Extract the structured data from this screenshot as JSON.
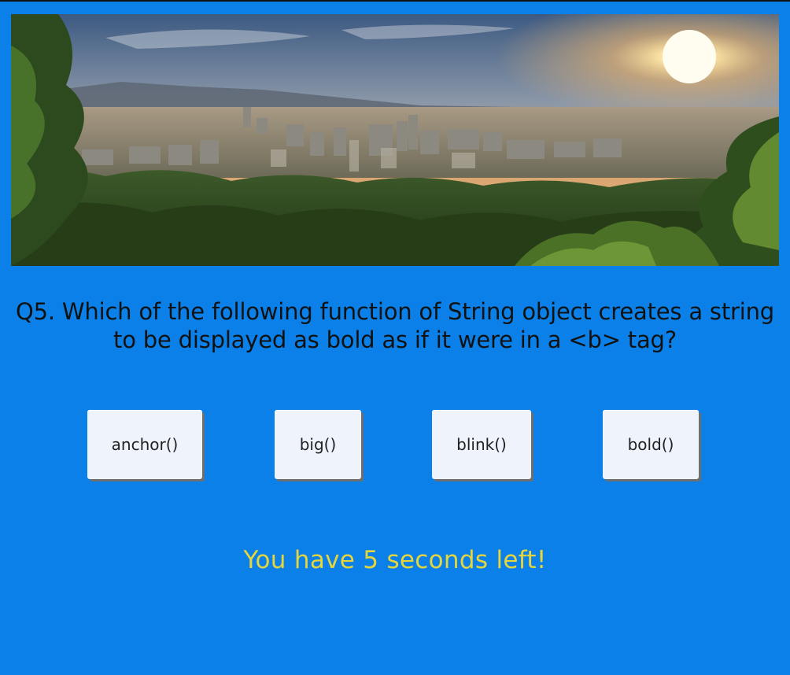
{
  "banner": {
    "image": "city-skyline-sunset-image"
  },
  "quiz": {
    "question_line1": "Q5. Which of the following function of String object creates a string",
    "question_line2": "to be displayed as bold as if it were in a <b> tag?",
    "answers": [
      {
        "label": "anchor()"
      },
      {
        "label": "big()"
      },
      {
        "label": "blink()"
      },
      {
        "label": "bold()"
      }
    ],
    "timer_text": "You have 5 seconds left!"
  },
  "colors": {
    "background": "#0a80e8",
    "button_bg": "#eef3fc",
    "timer_text": "#e6d53c",
    "question_text": "#111111"
  }
}
